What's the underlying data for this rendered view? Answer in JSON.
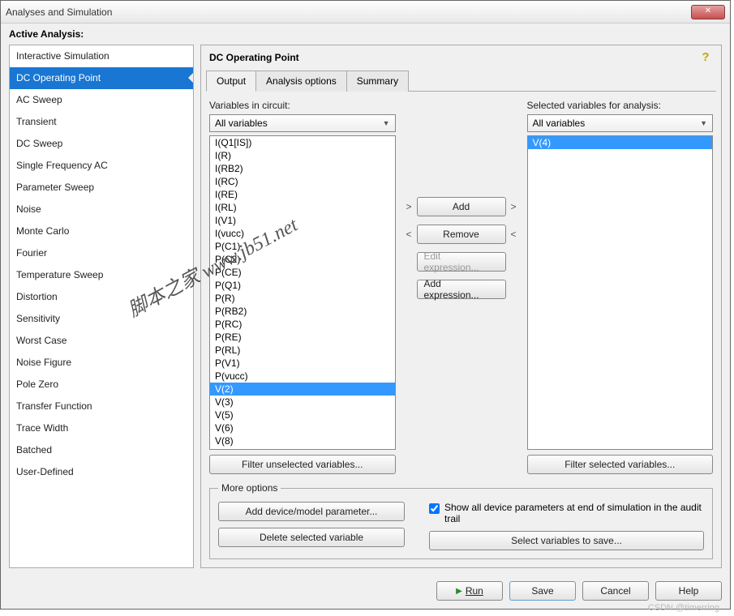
{
  "window": {
    "title": "Analyses and Simulation"
  },
  "active_header": "Active Analysis:",
  "sidebar": {
    "items": [
      "Interactive Simulation",
      "DC Operating Point",
      "AC Sweep",
      "Transient",
      "DC Sweep",
      "Single Frequency AC",
      "Parameter Sweep",
      "Noise",
      "Monte Carlo",
      "Fourier",
      "Temperature Sweep",
      "Distortion",
      "Sensitivity",
      "Worst Case",
      "Noise Figure",
      "Pole Zero",
      "Transfer Function",
      "Trace Width",
      "Batched",
      "User-Defined"
    ],
    "selected_index": 1
  },
  "panel": {
    "title": "DC Operating Point"
  },
  "tabs": {
    "items": [
      "Output",
      "Analysis options",
      "Summary"
    ],
    "active_index": 0
  },
  "left": {
    "label": "Variables in circuit:",
    "combo": "All variables",
    "list": [
      "I(Q1[IS])",
      "I(R)",
      "I(RB2)",
      "I(RC)",
      "I(RE)",
      "I(RL)",
      "I(V1)",
      "I(vucc)",
      "P(C1)",
      "P(C2)",
      "P(CE)",
      "P(Q1)",
      "P(R)",
      "P(RB2)",
      "P(RC)",
      "P(RE)",
      "P(RL)",
      "P(V1)",
      "P(vucc)",
      "V(2)",
      "V(3)",
      "V(5)",
      "V(6)",
      "V(8)"
    ],
    "selected_index": 19,
    "filter_btn": "Filter unselected variables..."
  },
  "mid": {
    "add": "Add",
    "remove": "Remove",
    "edit": "Edit expression...",
    "addexpr": "Add expression..."
  },
  "right": {
    "label": "Selected variables for analysis:",
    "combo": "All variables",
    "list": [
      "V(4)"
    ],
    "selected_index": 0,
    "filter_btn": "Filter selected variables..."
  },
  "more": {
    "legend": "More options",
    "add_param": "Add device/model parameter...",
    "del_var": "Delete selected variable",
    "show_all_label": "Show all device parameters at end of simulation in the audit trail",
    "show_all_checked": true,
    "select_save": "Select variables to save..."
  },
  "footer": {
    "run": "Run",
    "save": "Save",
    "cancel": "Cancel",
    "help": "Help"
  },
  "watermark": "脚本之家 www.jb51.net",
  "csdn": "CSDN @timerring"
}
